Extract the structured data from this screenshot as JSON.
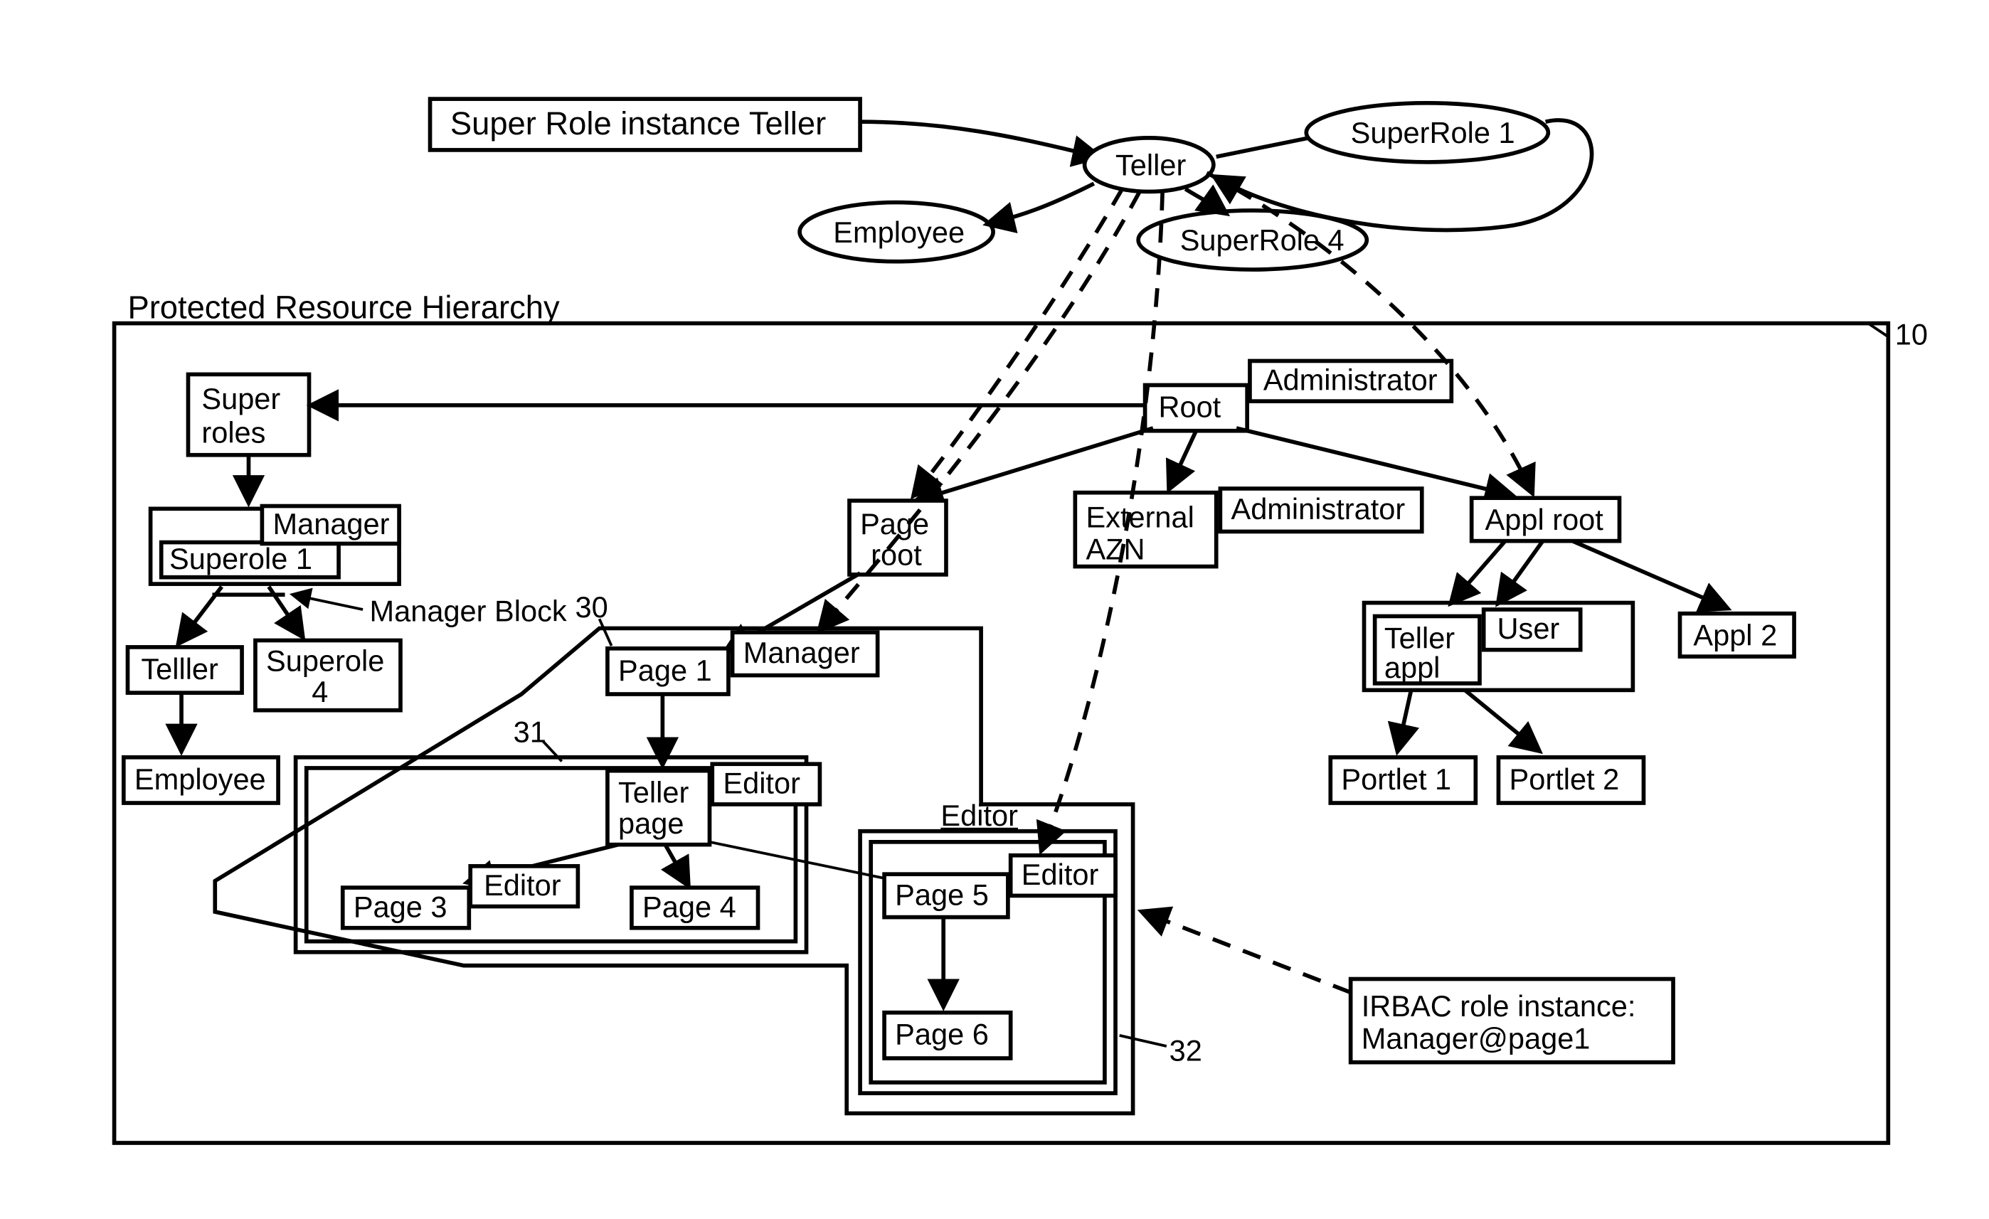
{
  "title_box": "Super Role instance Teller",
  "top_roles": {
    "teller": "Teller",
    "superrole1": "SuperRole 1",
    "employee": "Employee",
    "superrole4": "SuperRole 4"
  },
  "hierarchy_label": "Protected Resource Hierarchy",
  "container_num": "10",
  "left": {
    "super_roles": "Super\nroles",
    "manager": "Manager",
    "superole1": "Superole 1",
    "manager_block_label": "Manager Block",
    "teller": "Telller",
    "superole4": "Superole\n4",
    "employee": "Employee"
  },
  "mid": {
    "root": "Root",
    "root_admin": "Administrator",
    "page_root": "Page\nroot",
    "ext_azn": "External\nAZN",
    "ext_admin": "Administrator",
    "appl_root": "Appl root",
    "page1": "Page 1",
    "page1_manager": "Manager",
    "num30": "30",
    "teller_page": "Teller\npage",
    "teller_editor": "Editor",
    "num31": "31",
    "page3": "Page 3",
    "page3_editor": "Editor",
    "page4": "Page 4",
    "editor_u": "Editor",
    "page5": "Page 5",
    "page5_editor": "Editor",
    "page6": "Page 6",
    "num32": "32"
  },
  "right": {
    "teller_appl": "Teller\nappl",
    "user": "User",
    "appl2": "Appl 2",
    "portlet1": "Portlet 1",
    "portlet2": "Portlet 2"
  },
  "note": "IRBAC role instance:\nManager@page1"
}
